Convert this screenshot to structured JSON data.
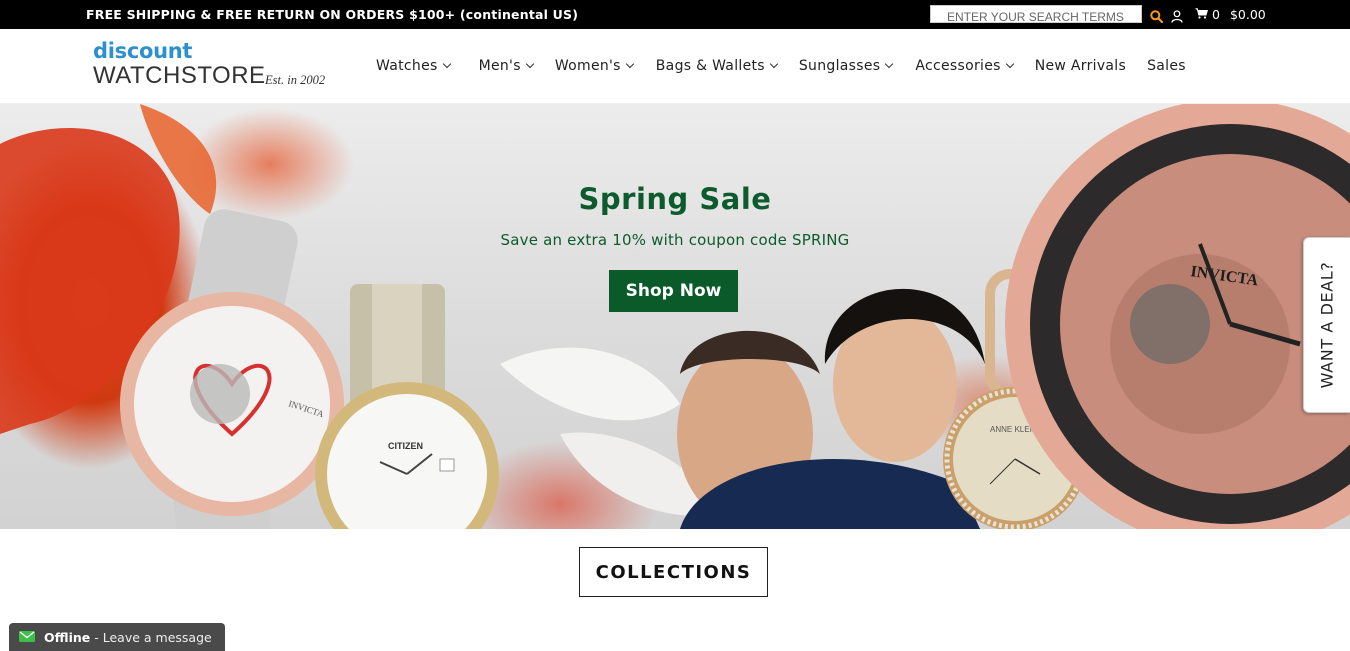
{
  "topbar": {
    "promo": "FREE SHIPPING & FREE RETURN ON ORDERS $100+ (continental US)",
    "search_placeholder": "ENTER YOUR SEARCH TERMS",
    "cart_count": "0",
    "cart_total": "$0.00"
  },
  "logo": {
    "line1": "discount",
    "line2": "WATCHSTORE",
    "tagline": "Est. in 2002"
  },
  "nav": {
    "items": [
      {
        "label": "Watches",
        "dropdown": true
      },
      {
        "label": "Men's",
        "dropdown": true
      },
      {
        "label": "Women's",
        "dropdown": true
      },
      {
        "label": "Bags & Wallets",
        "dropdown": true
      },
      {
        "label": "Sunglasses",
        "dropdown": true
      },
      {
        "label": "Accessories",
        "dropdown": true
      },
      {
        "label": "New Arrivals",
        "dropdown": false
      },
      {
        "label": "Sales",
        "dropdown": false
      }
    ]
  },
  "hero": {
    "title": "Spring Sale",
    "subtitle": "Save an extra 10% with coupon code SPRING",
    "cta": "Shop Now",
    "watch_brands": [
      "INVICTA",
      "CITIZEN",
      "ANNE KLEIN",
      "INVICTA"
    ]
  },
  "deal_tab": {
    "label": "WANT A DEAL?"
  },
  "collections": {
    "label": "COLLECTIONS"
  },
  "chat": {
    "status": "Offline",
    "message": "- Leave a message"
  },
  "colors": {
    "brand_green": "#0a5a2a",
    "logo_blue": "#2b8fd0",
    "topbar_bg": "#000000"
  }
}
